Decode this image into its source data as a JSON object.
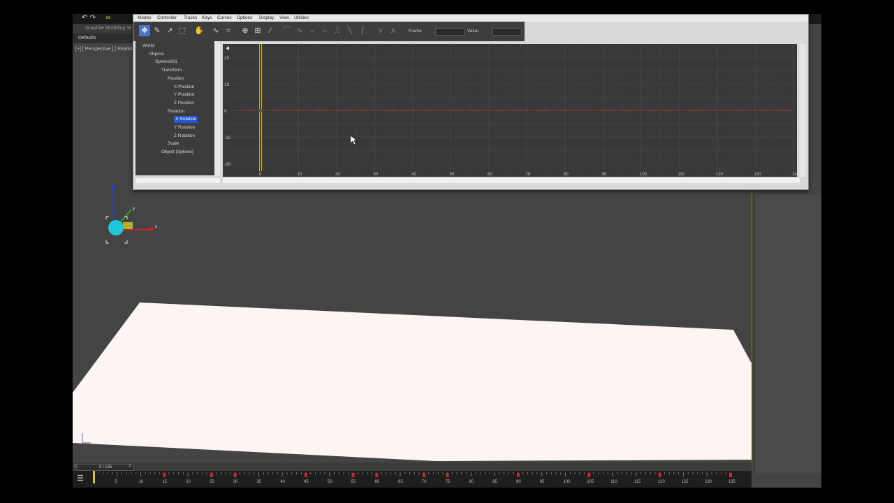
{
  "app": {
    "ribbon_label": "Graphite Modeling Te",
    "defaults_label": "Defaults",
    "viewport_label": "[+] [ Perspective ] [ Realistic ]",
    "colors": {
      "accent": "#1f57d6",
      "curve": "#c0392b",
      "keyline": "#c8b400",
      "plane": "#fdf4f4",
      "sphere": "#1ec8d8"
    }
  },
  "curve_editor": {
    "menu": [
      "Modes",
      "Controller",
      "Tracks",
      "Keys",
      "Curves",
      "Options",
      "Display",
      "View",
      "Utilities"
    ],
    "toolbar_icons": [
      "move-keys-icon",
      "draw-curves-icon",
      "insert-keys-icon",
      "region-icon",
      "pan-icon",
      "frame-horizontal-icon",
      "frame-value-icon",
      "zoom-icon",
      "zoom-region-icon",
      "isolate-curve-icon",
      "tangent-auto-icon",
      "tangent-spline-icon",
      "tangent-fast-icon",
      "tangent-slow-icon",
      "tangent-step-icon",
      "tangent-linear-icon",
      "tangent-smooth-icon",
      "show-tangents-icon",
      "lock-tangents-icon"
    ],
    "frame_label": "Frame",
    "value_label": "Value",
    "tree": [
      {
        "label": "World",
        "depth": 0
      },
      {
        "label": "Objects",
        "depth": 1
      },
      {
        "label": "Sphere001",
        "depth": 2
      },
      {
        "label": "Transform",
        "depth": 3
      },
      {
        "label": "Position",
        "depth": 4
      },
      {
        "label": "X Position",
        "depth": 5
      },
      {
        "label": "Y Position",
        "depth": 5
      },
      {
        "label": "Z Position",
        "depth": 5
      },
      {
        "label": "Rotation",
        "depth": 4
      },
      {
        "label": "X Rotation",
        "depth": 5,
        "selected": true
      },
      {
        "label": "Y Rotation",
        "depth": 5
      },
      {
        "label": "Z Rotation",
        "depth": 5
      },
      {
        "label": "Scale",
        "depth": 4
      },
      {
        "label": "Object (Sphere)",
        "depth": 3
      }
    ],
    "graph": {
      "y_ticks": [
        "20",
        "10",
        "0",
        "-10",
        "-20"
      ],
      "x_ticks": [
        "0",
        "10",
        "20",
        "30",
        "40",
        "50",
        "60",
        "70",
        "80",
        "90",
        "100",
        "110",
        "120",
        "130",
        "14"
      ],
      "current_frame": 0
    }
  },
  "timeline": {
    "time_display": "0 / 135",
    "ticks": [
      "5",
      "10",
      "15",
      "20",
      "25",
      "30",
      "35",
      "40",
      "45",
      "50",
      "55",
      "60",
      "65",
      "70",
      "75",
      "80",
      "85",
      "90",
      "95",
      "100",
      "105",
      "110",
      "115",
      "120",
      "125",
      "130",
      "135"
    ]
  }
}
